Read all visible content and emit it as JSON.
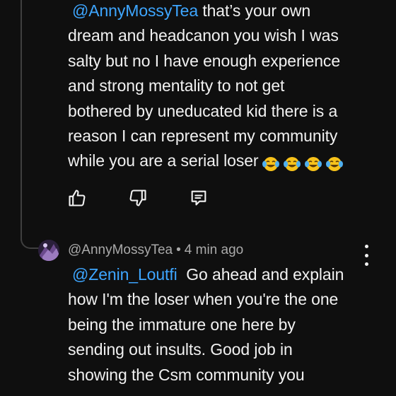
{
  "comment1": {
    "mention": "@AnnyMossyTea",
    "lines": [
      "that’s your own",
      "dream and headcanon you wish I was",
      "salty but no I have enough experience",
      "and strong mentality to not get",
      "bothered by uneducated kid there is a",
      "reason I can represent my community",
      "while you are a serial loser"
    ],
    "emojis": [
      "face-with-tears-of-joy",
      "face-with-tears-of-joy",
      "face-with-tears-of-joy",
      "face-with-tears-of-joy"
    ],
    "actions": {
      "like_icon": "thumbs-up-icon",
      "dislike_icon": "thumbs-down-icon",
      "reply_icon": "comment-icon"
    }
  },
  "comment2": {
    "author": "@AnnyMossyTea",
    "separator": "•",
    "time": "4 min ago",
    "mention": "@Zenin_Loutfi",
    "lines": [
      "Go ahead and explain",
      "how I'm the loser when you're the one",
      "being the immature one here by",
      "sending out insults. Good job in",
      "showing the Csm community you"
    ],
    "menu_icon": "more-vertical-icon"
  },
  "colors": {
    "background": "#0f0f0f",
    "text": "#f1f1f1",
    "mention": "#3ea6ff",
    "meta": "#aaaaaa",
    "thread_line": "#3f3f3f"
  }
}
